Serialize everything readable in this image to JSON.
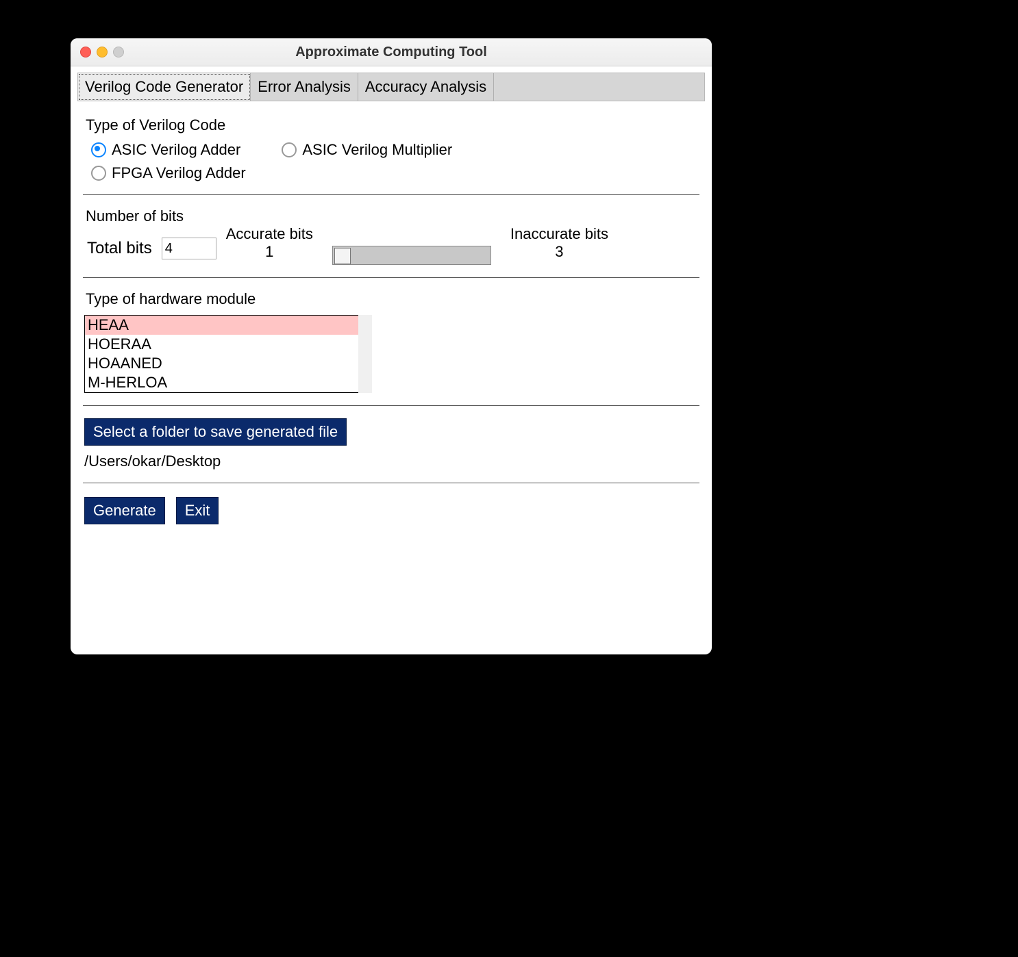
{
  "window": {
    "title": "Approximate Computing Tool"
  },
  "tabs": [
    {
      "label": "Verilog Code Generator",
      "active": true
    },
    {
      "label": "Error Analysis",
      "active": false
    },
    {
      "label": "Accuracy Analysis",
      "active": false
    }
  ],
  "section_type_label": "Type of Verilog Code",
  "radios": {
    "asic_adder": "ASIC Verilog Adder",
    "asic_mult": "ASIC Verilog Multiplier",
    "fpga_adder": "FPGA Verilog Adder",
    "selected": "asic_adder"
  },
  "bits": {
    "section_label": "Number of bits",
    "total_label": "Total bits",
    "total_value": "4",
    "accurate_label": "Accurate bits",
    "accurate_value": "1",
    "inaccurate_label": "Inaccurate bits",
    "inaccurate_value": "3"
  },
  "hw_section_label": "Type of hardware module",
  "hw_modules": [
    "HEAA",
    "HOERAA",
    "HOAANED",
    "M-HERLOA"
  ],
  "hw_selected_index": 0,
  "folder_button": "Select a folder to save generated file",
  "folder_path": "/Users/okar/Desktop",
  "buttons": {
    "generate": "Generate",
    "exit": "Exit"
  }
}
